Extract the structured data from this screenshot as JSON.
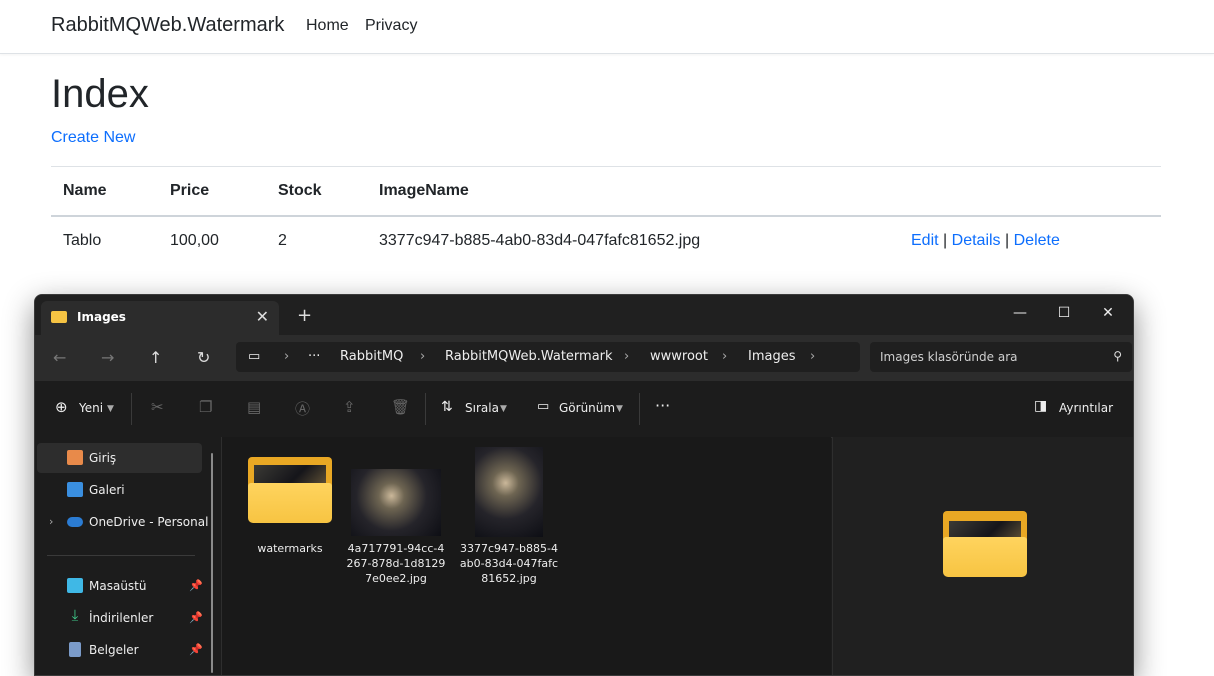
{
  "web": {
    "brand": "RabbitMQWeb.Watermark",
    "nav": [
      "Home",
      "Privacy"
    ],
    "title": "Index",
    "create_new": "Create New",
    "table": {
      "headers": [
        "Name",
        "Price",
        "Stock",
        "ImageName"
      ],
      "rows": [
        {
          "name": "Tablo",
          "price": "100,00",
          "stock": "2",
          "image": "3377c947-b885-4ab0-83d4-047fafc81652.jpg"
        }
      ],
      "actions": {
        "edit": "Edit",
        "details": "Details",
        "delete": "Delete",
        "sep": "|"
      }
    }
  },
  "explorer": {
    "tab_title": "Images",
    "breadcrumb": [
      "RabbitMQ",
      "RabbitMQWeb.Watermark",
      "wwwroot",
      "Images"
    ],
    "breadcrumb_more": "···",
    "search_placeholder": "Images klasöründe ara",
    "toolbar": {
      "new": "Yeni",
      "sort": "Sırala",
      "view": "Görünüm",
      "more": "···",
      "details": "Ayrıntılar"
    },
    "sidebar": [
      {
        "label": "Giriş",
        "icon": "home-icon",
        "selected": true
      },
      {
        "label": "Galeri",
        "icon": "gallery-icon"
      },
      {
        "label": "OneDrive - Personal",
        "icon": "onedrive-icon"
      },
      {
        "label": "Masaüstü",
        "icon": "desktop-icon",
        "pinned": true
      },
      {
        "label": "İndirilenler",
        "icon": "downloads-icon",
        "pinned": true
      },
      {
        "label": "Belgeler",
        "icon": "documents-icon",
        "pinned": true
      }
    ],
    "files": [
      {
        "name_lines": [
          "watermarks"
        ],
        "type": "folder"
      },
      {
        "name_lines": [
          "4a717791-94cc-4",
          "267-878d-1d8129",
          "7e0ee2.jpg"
        ],
        "type": "image"
      },
      {
        "name_lines": [
          "3377c947-b885-4",
          "ab0-83d4-047fafc",
          "81652.jpg"
        ],
        "type": "image"
      }
    ]
  },
  "colors": {
    "link": "#0d6efd",
    "folder": "#f7c442",
    "dark_bg": "#1c1c1c"
  }
}
